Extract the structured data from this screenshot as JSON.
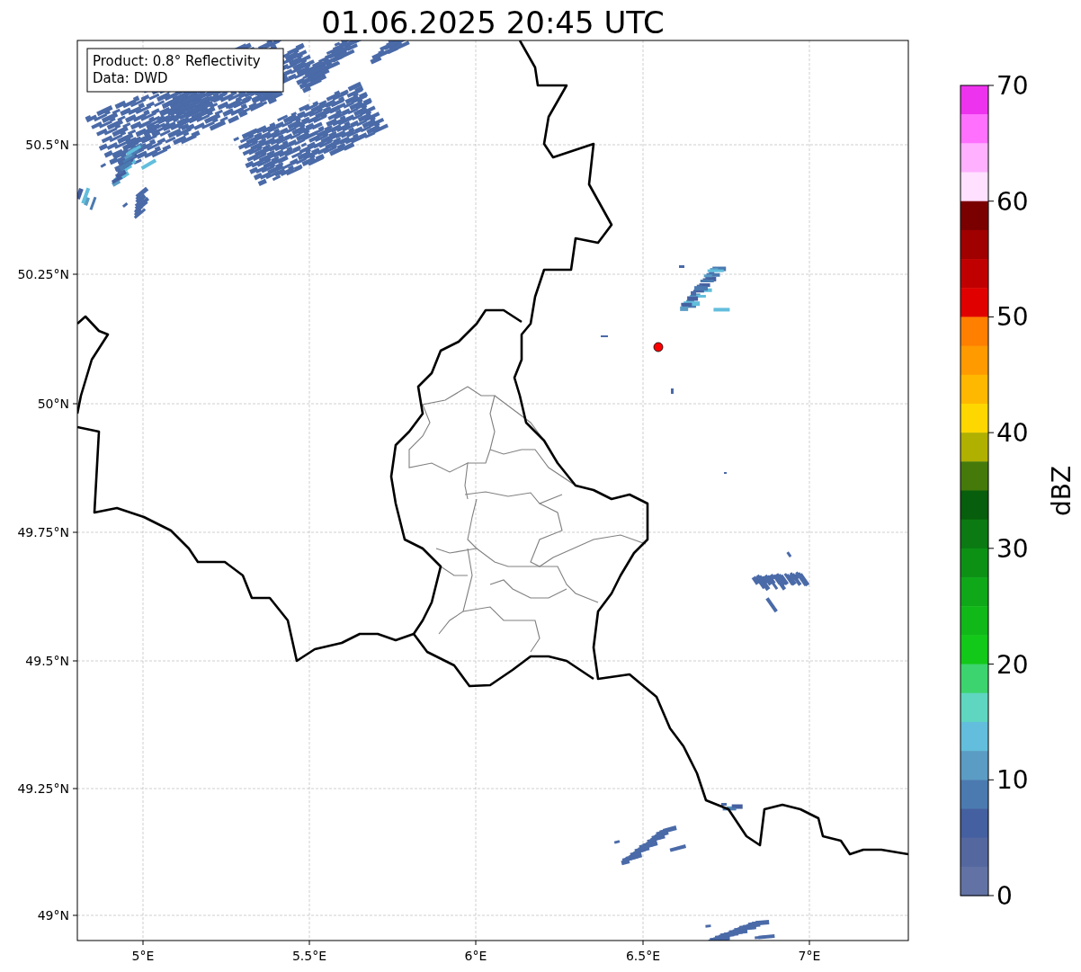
{
  "title": "01.06.2025 20:45 UTC",
  "info_box": [
    "Product: 0.8° Reflectivity",
    "Data: DWD"
  ],
  "xticks": [
    "5°E",
    "5.5°E",
    "6°E",
    "6.5°E",
    "7°E"
  ],
  "yticks": [
    "50.5°N",
    "50.25°N",
    "50°N",
    "49.75°N",
    "49.5°N",
    "49.25°N",
    "49°N"
  ],
  "colorbar": {
    "label": "dBZ",
    "ticks": [
      "70",
      "60",
      "50",
      "40",
      "30",
      "20",
      "10",
      "0"
    ],
    "bins": [
      {
        "color": "#ee33ee"
      },
      {
        "color": "#ff70ff"
      },
      {
        "color": "#ffb0ff"
      },
      {
        "color": "#ffe0ff"
      },
      {
        "color": "#7a0000"
      },
      {
        "color": "#a00000"
      },
      {
        "color": "#c00000"
      },
      {
        "color": "#e00000"
      },
      {
        "color": "#ff7f00"
      },
      {
        "color": "#ff9a00"
      },
      {
        "color": "#ffb800"
      },
      {
        "color": "#ffd700"
      },
      {
        "color": "#b0b000"
      },
      {
        "color": "#457a0a"
      },
      {
        "color": "#075e0c"
      },
      {
        "color": "#0b7a12"
      },
      {
        "color": "#0d9115"
      },
      {
        "color": "#0fa818"
      },
      {
        "color": "#10b818"
      },
      {
        "color": "#12c818"
      },
      {
        "color": "#3cd46e"
      },
      {
        "color": "#5fd6c0"
      },
      {
        "color": "#62bedc"
      },
      {
        "color": "#5a9cc4"
      },
      {
        "color": "#4a7ab0"
      },
      {
        "color": "#4560a0"
      },
      {
        "color": "#54679f"
      },
      {
        "color": "#6272a4"
      }
    ]
  }
}
